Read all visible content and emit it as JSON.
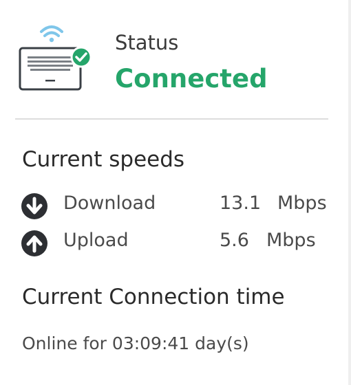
{
  "status": {
    "label": "Status",
    "value": "Connected",
    "color": "#25a56a",
    "icon": "laptop-wifi-connected-icon"
  },
  "speeds": {
    "title": "Current speeds",
    "download": {
      "label": "Download",
      "value": "13.1",
      "unit": "Mbps",
      "icon": "arrow-down-circle-icon"
    },
    "upload": {
      "label": "Upload",
      "value": "5.6",
      "unit": "Mbps",
      "icon": "arrow-up-circle-icon"
    }
  },
  "connection": {
    "title": "Current Connection time",
    "text": "Online for 03:09:41 day(s)"
  }
}
